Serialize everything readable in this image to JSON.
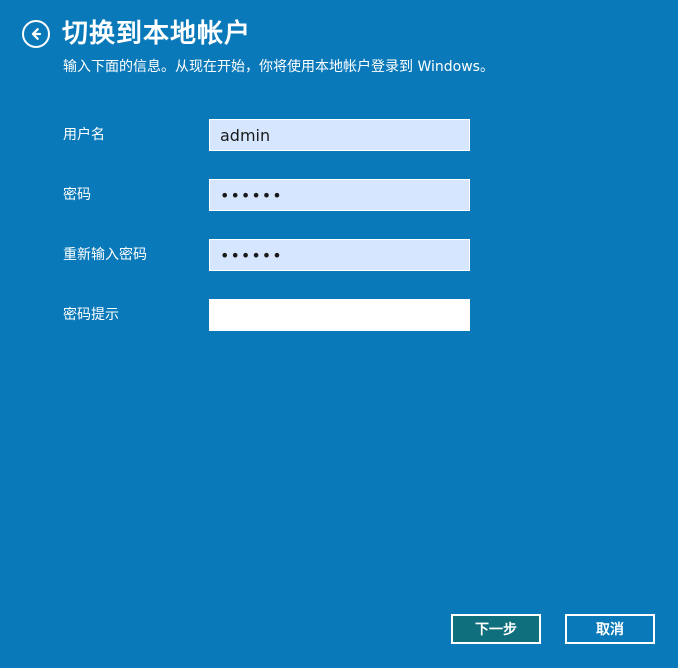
{
  "header": {
    "title": "切换到本地帐户",
    "subtitle": "输入下面的信息。从现在开始，你将使用本地帐户登录到 Windows。"
  },
  "form": {
    "username": {
      "label": "用户名",
      "value": "admin"
    },
    "password": {
      "label": "密码",
      "value": "••••••"
    },
    "confirm_password": {
      "label": "重新输入密码",
      "value": "••••••"
    },
    "password_hint": {
      "label": "密码提示",
      "value": ""
    }
  },
  "buttons": {
    "next": "下一步",
    "cancel": "取消"
  },
  "icons": {
    "back": "arrow-left-circle"
  },
  "colors": {
    "background": "#0a79ba",
    "input_fill": "#d6e6ff",
    "input_empty": "#ffffff",
    "next_button": "#0f6f7c",
    "text": "#ffffff"
  }
}
